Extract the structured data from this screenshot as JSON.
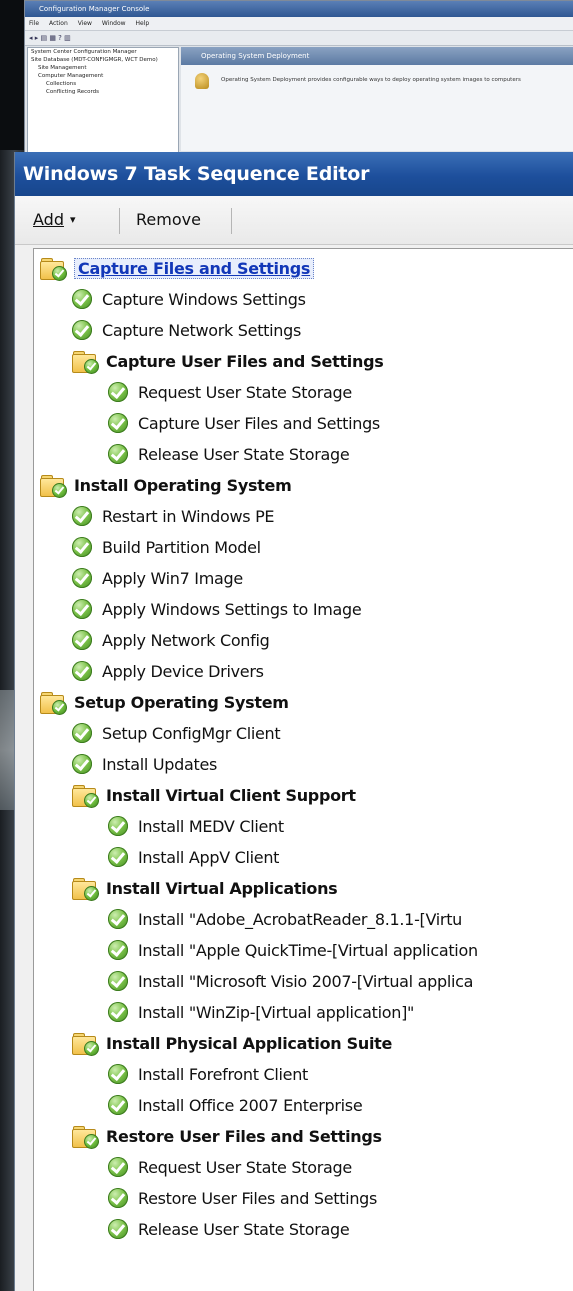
{
  "background_window": {
    "title": "Configuration Manager Console",
    "menu": [
      "File",
      "Action",
      "View",
      "Window",
      "Help"
    ],
    "tree_items": [
      "System Center Configuration Manager",
      "Site Database (MDT-CONFIGMGR, WCT Demo)",
      "Site Management",
      "Computer Management",
      "Collections",
      "Conflicting Records"
    ],
    "pane_header": "Operating System Deployment",
    "pane_text": "Operating System Deployment provides configurable ways to deploy operating system images to computers"
  },
  "editor": {
    "title": "Windows 7 Task Sequence Editor",
    "toolbar": {
      "add_label": "Add",
      "add_caret": "▾",
      "remove_label": "Remove"
    },
    "steps": [
      {
        "label": "Capture Files and Settings",
        "type": "group",
        "level": 0,
        "selected": true
      },
      {
        "label": "Capture Windows Settings",
        "type": "step",
        "level": 1
      },
      {
        "label": "Capture Network Settings",
        "type": "step",
        "level": 1
      },
      {
        "label": "Capture User Files and Settings",
        "type": "group",
        "level": 1
      },
      {
        "label": "Request User State Storage",
        "type": "step",
        "level": 2
      },
      {
        "label": "Capture User Files and Settings",
        "type": "step",
        "level": 2
      },
      {
        "label": "Release User State Storage",
        "type": "step",
        "level": 2
      },
      {
        "label": "Install Operating System",
        "type": "group",
        "level": 0
      },
      {
        "label": "Restart in Windows PE",
        "type": "step",
        "level": 1
      },
      {
        "label": "Build Partition Model",
        "type": "step",
        "level": 1
      },
      {
        "label": "Apply Win7 Image",
        "type": "step",
        "level": 1
      },
      {
        "label": "Apply Windows Settings to Image",
        "type": "step",
        "level": 1
      },
      {
        "label": "Apply Network Config",
        "type": "step",
        "level": 1
      },
      {
        "label": "Apply Device Drivers",
        "type": "step",
        "level": 1
      },
      {
        "label": "Setup Operating System",
        "type": "group",
        "level": 0
      },
      {
        "label": "Setup ConfigMgr Client",
        "type": "step",
        "level": 1
      },
      {
        "label": "Install Updates",
        "type": "step",
        "level": 1
      },
      {
        "label": "Install Virtual Client Support",
        "type": "group",
        "level": 1
      },
      {
        "label": "Install MEDV Client",
        "type": "step",
        "level": 2
      },
      {
        "label": "Install AppV Client",
        "type": "step",
        "level": 2
      },
      {
        "label": "Install Virtual Applications",
        "type": "group",
        "level": 1
      },
      {
        "label": "Install \"Adobe_AcrobatReader_8.1.1-[Virtu",
        "type": "step",
        "level": 2
      },
      {
        "label": "Install \"Apple QuickTime-[Virtual application",
        "type": "step",
        "level": 2
      },
      {
        "label": "Install \"Microsoft Visio 2007-[Virtual applica",
        "type": "step",
        "level": 2
      },
      {
        "label": "Install \"WinZip-[Virtual application]\"",
        "type": "step",
        "level": 2
      },
      {
        "label": "Install Physical Application Suite",
        "type": "group",
        "level": 1
      },
      {
        "label": "Install Forefront Client",
        "type": "step",
        "level": 2
      },
      {
        "label": "Install Office 2007 Enterprise",
        "type": "step",
        "level": 2
      },
      {
        "label": "Restore User Files and Settings",
        "type": "group",
        "level": 1
      },
      {
        "label": "Request User State Storage",
        "type": "step",
        "level": 2
      },
      {
        "label": "Restore User Files and Settings",
        "type": "step",
        "level": 2
      },
      {
        "label": "Release User State Storage",
        "type": "step",
        "level": 2
      }
    ]
  },
  "colors": {
    "title_bar": "#1d4f9c",
    "selected_text": "#1237b8",
    "check_green": "#6fbd3e",
    "folder_yellow": "#f1c14b"
  }
}
